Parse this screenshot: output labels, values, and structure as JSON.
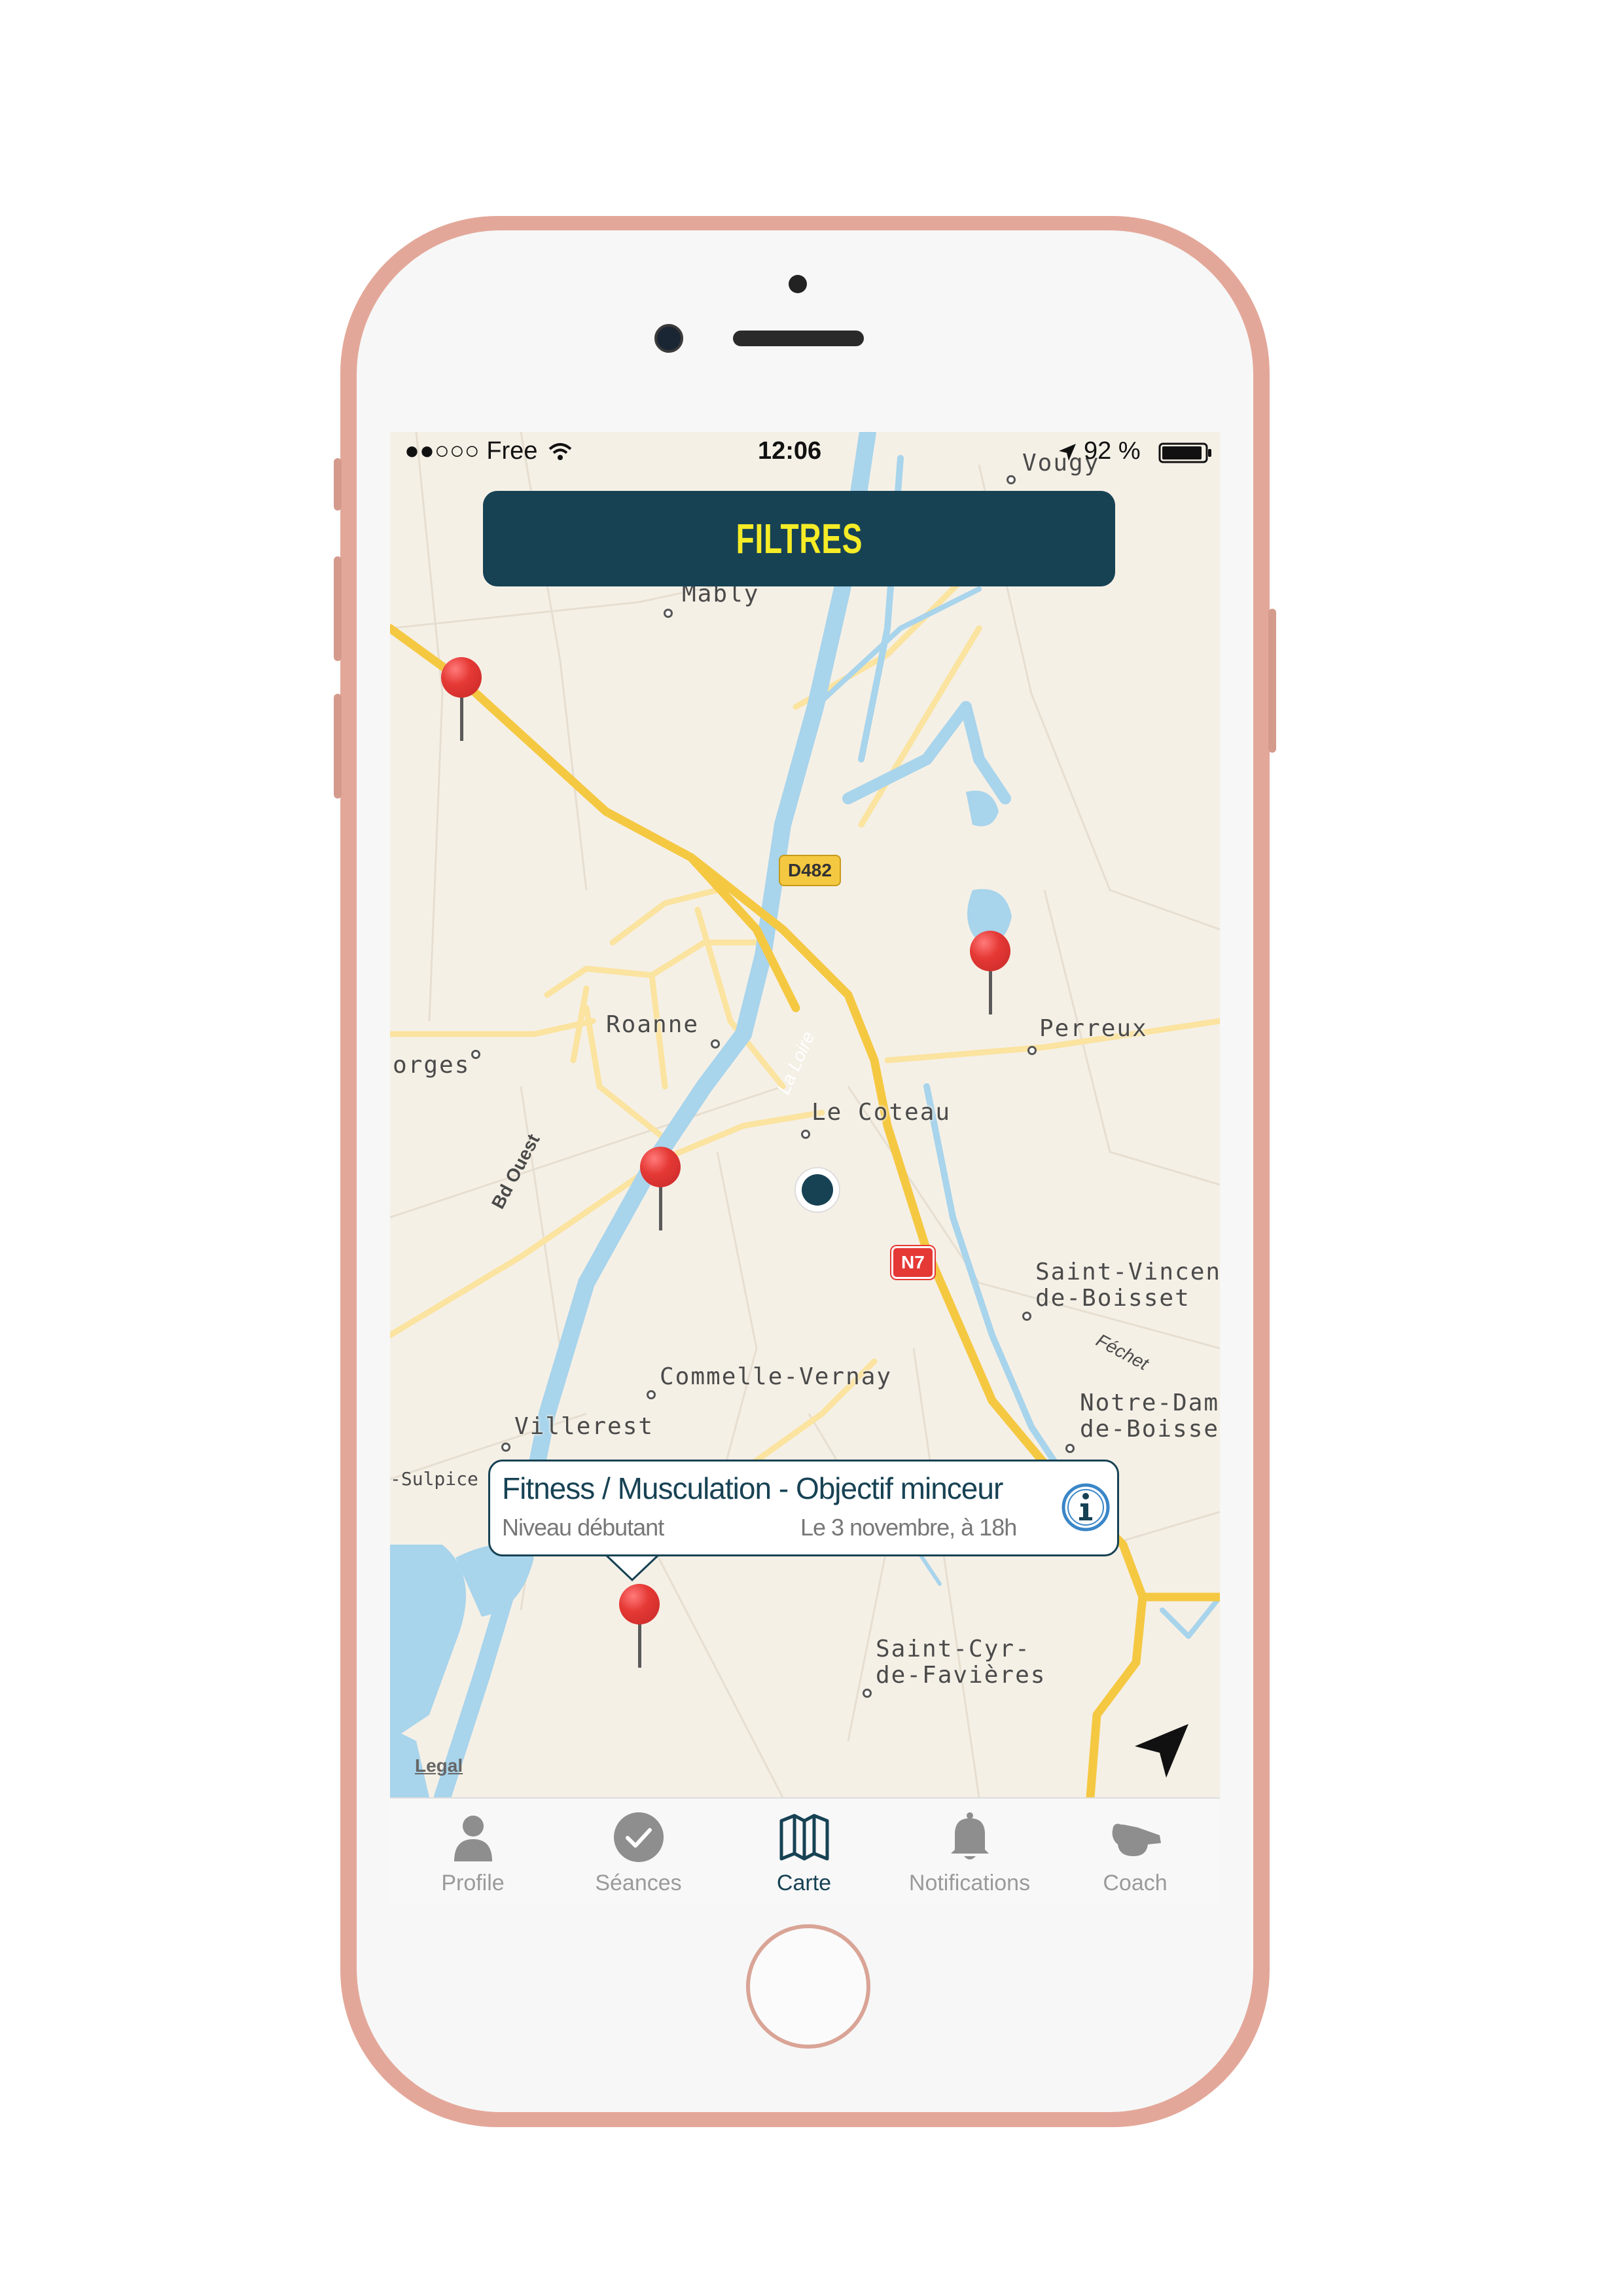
{
  "status_bar": {
    "carrier": "●●○○○ Free",
    "time": "12:06",
    "battery": "92 %"
  },
  "filter_button": {
    "label": "FILTRES"
  },
  "map": {
    "places": [
      {
        "key": "mably",
        "label": "Mably"
      },
      {
        "key": "vougy",
        "label": "Vougy"
      },
      {
        "key": "roanne",
        "label": "Roanne"
      },
      {
        "key": "perreux",
        "label": "Perreux"
      },
      {
        "key": "orges",
        "label": "orges"
      },
      {
        "key": "le_coteau",
        "label": "Le Coteau"
      },
      {
        "key": "saint_vincent_1",
        "label": "Saint-Vincent-"
      },
      {
        "key": "saint_vincent_2",
        "label": "de-Boisset"
      },
      {
        "key": "commelle",
        "label": "Commelle-Vernay"
      },
      {
        "key": "notre_dame_1",
        "label": "Notre-Dam"
      },
      {
        "key": "notre_dame_2",
        "label": "de-Boisset"
      },
      {
        "key": "villerest",
        "label": "Villerest"
      },
      {
        "key": "sulpice",
        "label": "-Sulpice"
      },
      {
        "key": "saint_cyr_1",
        "label": "Saint-Cyr-"
      },
      {
        "key": "saint_cyr_2",
        "label": "de-Favières"
      }
    ],
    "street_labels": {
      "bd_ouest": "Bd Ouest",
      "la_loire": "La Loire",
      "fechet": "Féchet"
    },
    "road_signs": {
      "d482": "D482",
      "n7": "N7"
    },
    "legal": "Legal"
  },
  "callout": {
    "title": "Fitness / Musculation  -  Objectif minceur",
    "level": "Niveau débutant",
    "date": "Le 3 novembre, à 18h"
  },
  "tab_bar": {
    "tabs": [
      {
        "label": "Profile",
        "icon": "person-icon",
        "active": false
      },
      {
        "label": "Séances",
        "icon": "checkmark-circle-icon",
        "active": false
      },
      {
        "label": "Carte",
        "icon": "map-icon",
        "active": true
      },
      {
        "label": "Notifications",
        "icon": "bell-icon",
        "active": false
      },
      {
        "label": "Coach",
        "icon": "whistle-icon",
        "active": false
      }
    ]
  },
  "colors": {
    "accent": "#174254",
    "filter_text": "#f5ec27",
    "pin": "#e53935",
    "map_background": "#f5f0e6",
    "water": "#a8d4ec",
    "road": "#f5c842"
  }
}
